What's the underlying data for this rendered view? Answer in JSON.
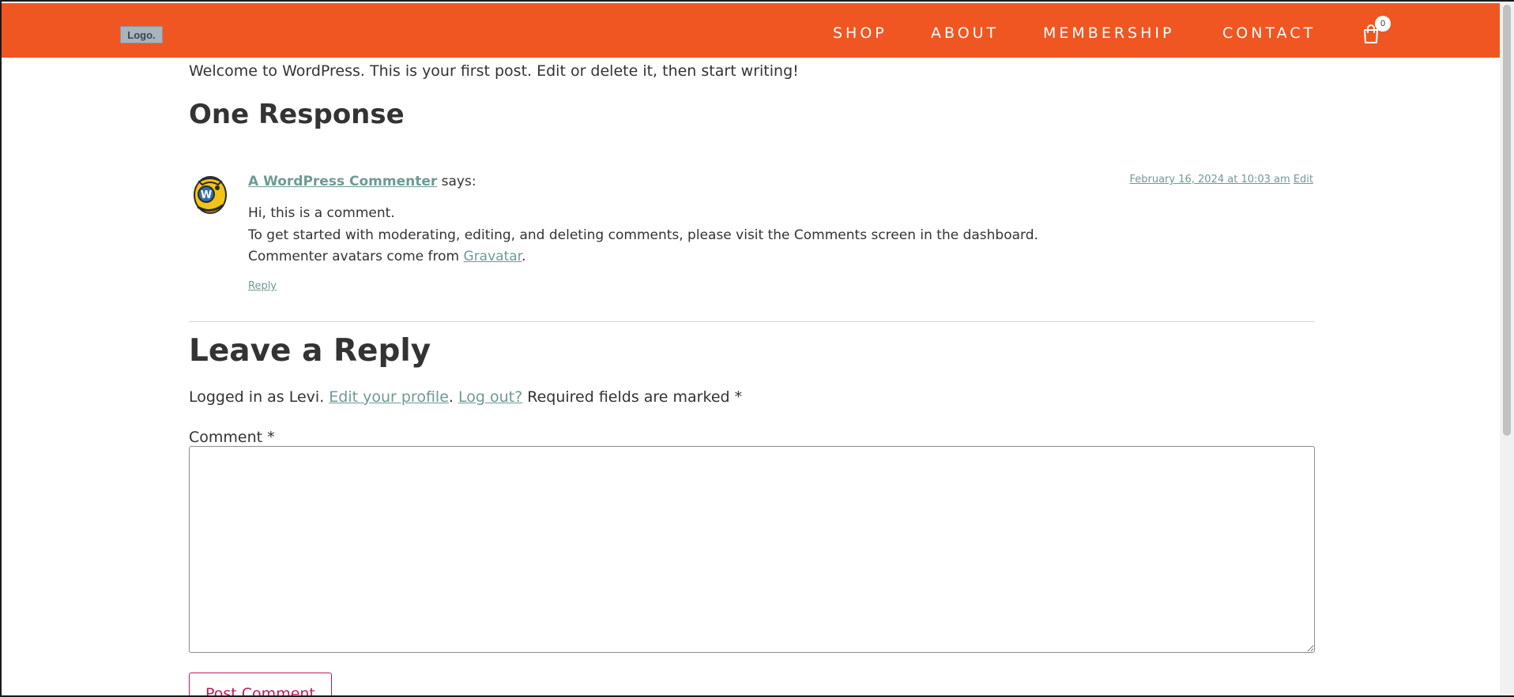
{
  "colors": {
    "brand": "#f05622",
    "link": "#6e9a94",
    "button": "#c2185b"
  },
  "header": {
    "logo": "Logo.",
    "nav": [
      {
        "label": "SHOP"
      },
      {
        "label": "ABOUT"
      },
      {
        "label": "MEMBERSHIP"
      },
      {
        "label": "CONTACT"
      }
    ],
    "cart": {
      "icon": "shopping-bag-icon",
      "count": "0"
    }
  },
  "post": {
    "intro": "Welcome to WordPress. This is your first post. Edit or delete it, then start writing!"
  },
  "comments": {
    "title": "One Response",
    "items": [
      {
        "avatar": "wordpress-commenter-avatar",
        "author": "A WordPress Commenter",
        "says": "says:",
        "date": "February 16, 2024 at 10:03 am",
        "edit": "Edit",
        "lines": [
          "Hi, this is a comment.",
          "To get started with moderating, editing, and deleting comments, please visit the Comments screen in the dashboard.",
          "Commenter avatars come from "
        ],
        "gravatar_link": "Gravatar",
        "gravatar_suffix": ".",
        "reply": "Reply"
      }
    ]
  },
  "reply_form": {
    "title": "Leave a Reply",
    "logged_in_prefix": "Logged in as Levi. ",
    "edit_profile": "Edit your profile",
    "separator": ". ",
    "log_out": "Log out?",
    "required_note": " Required fields are marked *",
    "comment_label": "Comment *",
    "comment_value": "",
    "submit_label": "Post Comment"
  }
}
